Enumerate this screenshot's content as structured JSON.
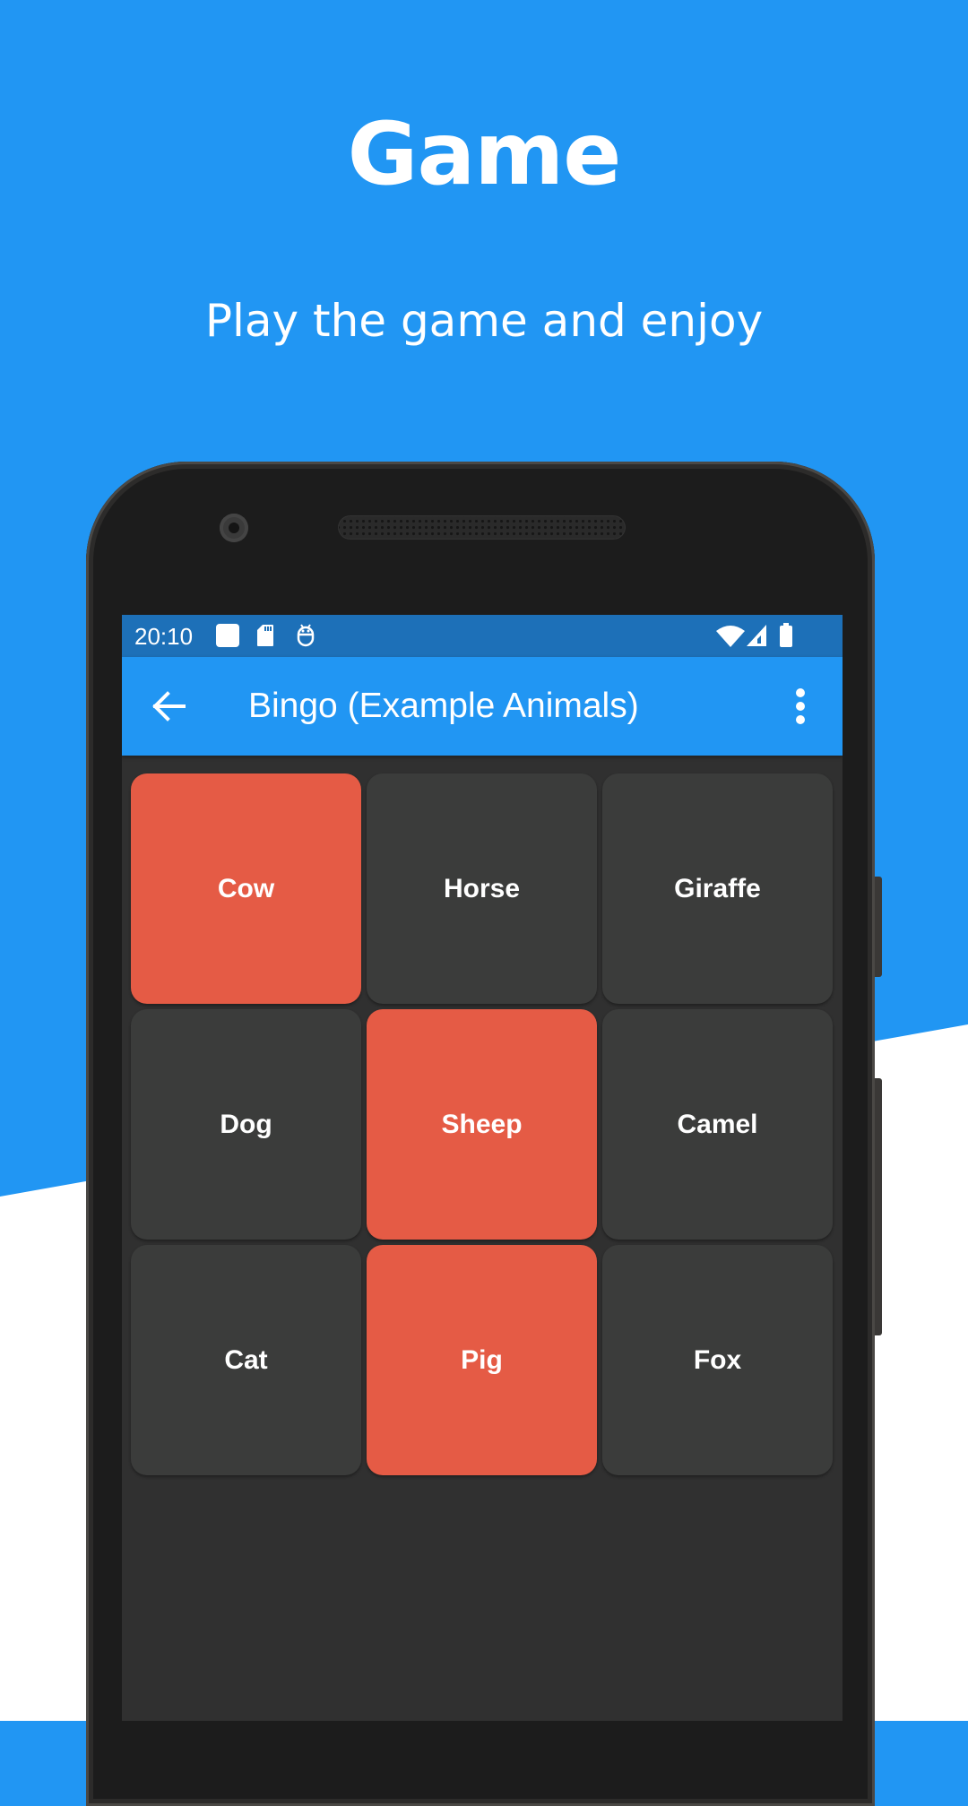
{
  "promo": {
    "headline": "Game",
    "subline": "Play the game and enjoy"
  },
  "status_bar": {
    "time": "20:10",
    "left_icons": [
      "notification-square-icon",
      "sd-card-icon",
      "debug-android-icon"
    ],
    "right_icons": [
      "wifi-icon",
      "cell-signal-icon",
      "battery-icon"
    ]
  },
  "app_bar": {
    "back_icon": "arrow-back-icon",
    "title": "Bingo (Example Animals)",
    "menu_icon": "more-vert-icon"
  },
  "colors": {
    "brand_blue": "#2196F3",
    "status_bar": "#1D70B8",
    "marked_cell": "#E55B45",
    "unmarked_cell": "#3B3C3B",
    "screen_bg": "#303030"
  },
  "board": {
    "rows": 3,
    "cols": 3,
    "cells": [
      {
        "label": "Cow",
        "marked": true
      },
      {
        "label": "Horse",
        "marked": false
      },
      {
        "label": "Giraffe",
        "marked": false
      },
      {
        "label": "Dog",
        "marked": false
      },
      {
        "label": "Sheep",
        "marked": true
      },
      {
        "label": "Camel",
        "marked": false
      },
      {
        "label": "Cat",
        "marked": false
      },
      {
        "label": "Pig",
        "marked": true
      },
      {
        "label": "Fox",
        "marked": false
      }
    ]
  }
}
